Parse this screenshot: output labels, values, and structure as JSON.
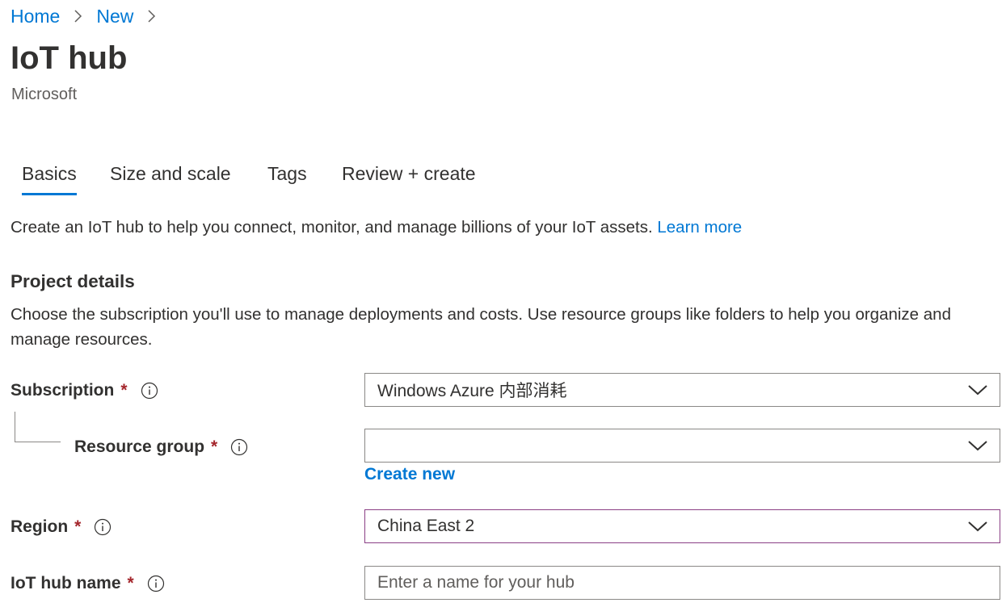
{
  "breadcrumb": {
    "items": [
      "Home",
      "New"
    ]
  },
  "header": {
    "title": "IoT hub",
    "publisher": "Microsoft"
  },
  "tabs": [
    {
      "label": "Basics",
      "active": true
    },
    {
      "label": "Size and scale",
      "active": false
    },
    {
      "label": "Tags",
      "active": false
    },
    {
      "label": "Review + create",
      "active": false
    }
  ],
  "intro": {
    "text": "Create an IoT hub to help you connect, monitor, and manage billions of your IoT assets.",
    "link": "Learn more"
  },
  "project": {
    "heading": "Project details",
    "description": "Choose the subscription you'll use to manage deployments and costs. Use resource groups like folders to help you organize and manage resources."
  },
  "form": {
    "required_mark": "*",
    "subscription": {
      "label": "Subscription",
      "value": "Windows Azure 内部消耗"
    },
    "resource_group": {
      "label": "Resource group",
      "value": "",
      "create_new": "Create new"
    },
    "region": {
      "label": "Region",
      "value": "China East 2"
    },
    "hub_name": {
      "label": "IoT hub name",
      "value": "",
      "placeholder": "Enter a name for your hub"
    }
  },
  "icons": {
    "breadcrumb_separator": "chevron-right-icon",
    "info": "info-icon",
    "dropdown": "chevron-down-icon"
  },
  "colors": {
    "accent": "#0078d4",
    "required": "#a4262c",
    "focused_border": "#8b3f85",
    "text": "#323130",
    "secondary_text": "#605e5c",
    "border": "#8a8886"
  }
}
